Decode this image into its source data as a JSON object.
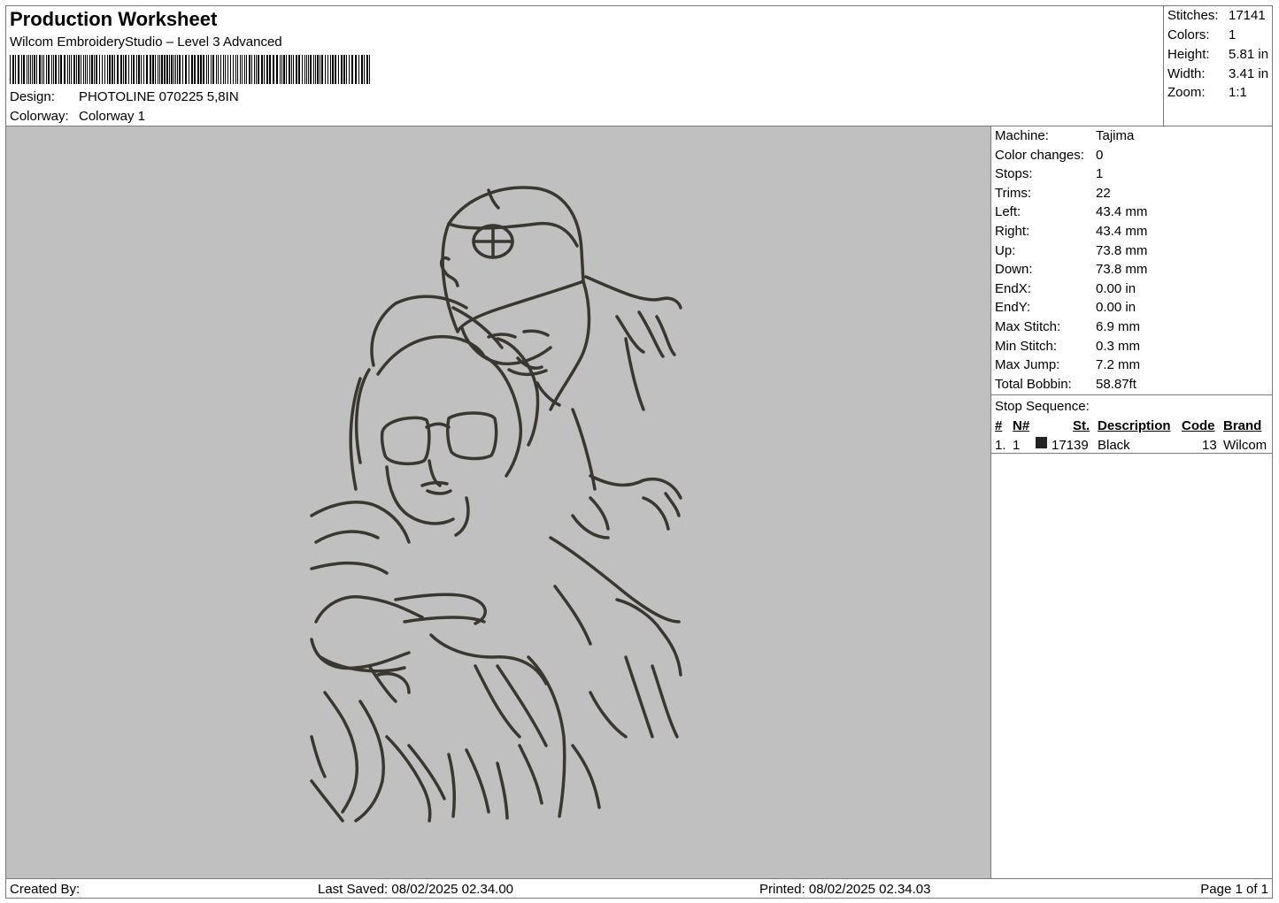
{
  "header": {
    "title": "Production Worksheet",
    "app": "Wilcom EmbroideryStudio – Level 3 Advanced",
    "design_label": "Design:",
    "design_value": "PHOTOLINE 070225 5,8IN",
    "colorway_label": "Colorway:",
    "colorway_value": "Colorway 1"
  },
  "summary": {
    "stitches_label": "Stitches:",
    "stitches": "17141",
    "colors_label": "Colors:",
    "colors": "1",
    "height_label": "Height:",
    "height": "5.81 in",
    "width_label": "Width:",
    "width": "3.41 in",
    "zoom_label": "Zoom:",
    "zoom": "1:1"
  },
  "machine_info": [
    {
      "label": "Machine:",
      "value": "Tajima"
    },
    {
      "label": "Color changes:",
      "value": "0"
    },
    {
      "label": "Stops:",
      "value": "1"
    },
    {
      "label": "Trims:",
      "value": "22"
    },
    {
      "label": "Left:",
      "value": "43.4 mm"
    },
    {
      "label": "Right:",
      "value": "43.4 mm"
    },
    {
      "label": "Up:",
      "value": "73.8 mm"
    },
    {
      "label": "Down:",
      "value": "73.8 mm"
    },
    {
      "label": "EndX:",
      "value": "0.00 in"
    },
    {
      "label": "EndY:",
      "value": "0.00 in"
    },
    {
      "label": "Max Stitch:",
      "value": "6.9 mm"
    },
    {
      "label": "Min Stitch:",
      "value": "0.3 mm"
    },
    {
      "label": "Max Jump:",
      "value": "7.2 mm"
    },
    {
      "label": "Total Bobbin:",
      "value": "58.87ft"
    }
  ],
  "stop_sequence": {
    "title": "Stop Sequence:",
    "columns": [
      "#",
      "N#",
      "St.",
      "Description",
      "Code",
      "Brand"
    ],
    "rows": [
      {
        "index": "1.",
        "n": "1",
        "stitches": "17139",
        "description": "Black",
        "code": "13",
        "brand": "Wilcom",
        "color": "#222222"
      }
    ]
  },
  "footer": {
    "created_by": "Created By:",
    "last_saved": "Last Saved: 08/02/2025 02.34.00",
    "printed": "Printed: 08/02/2025 02.34.03",
    "page": "Page 1 of 1"
  },
  "colors": {
    "canvas_bg": "#c0c0c0",
    "thread": "#3a3630"
  }
}
